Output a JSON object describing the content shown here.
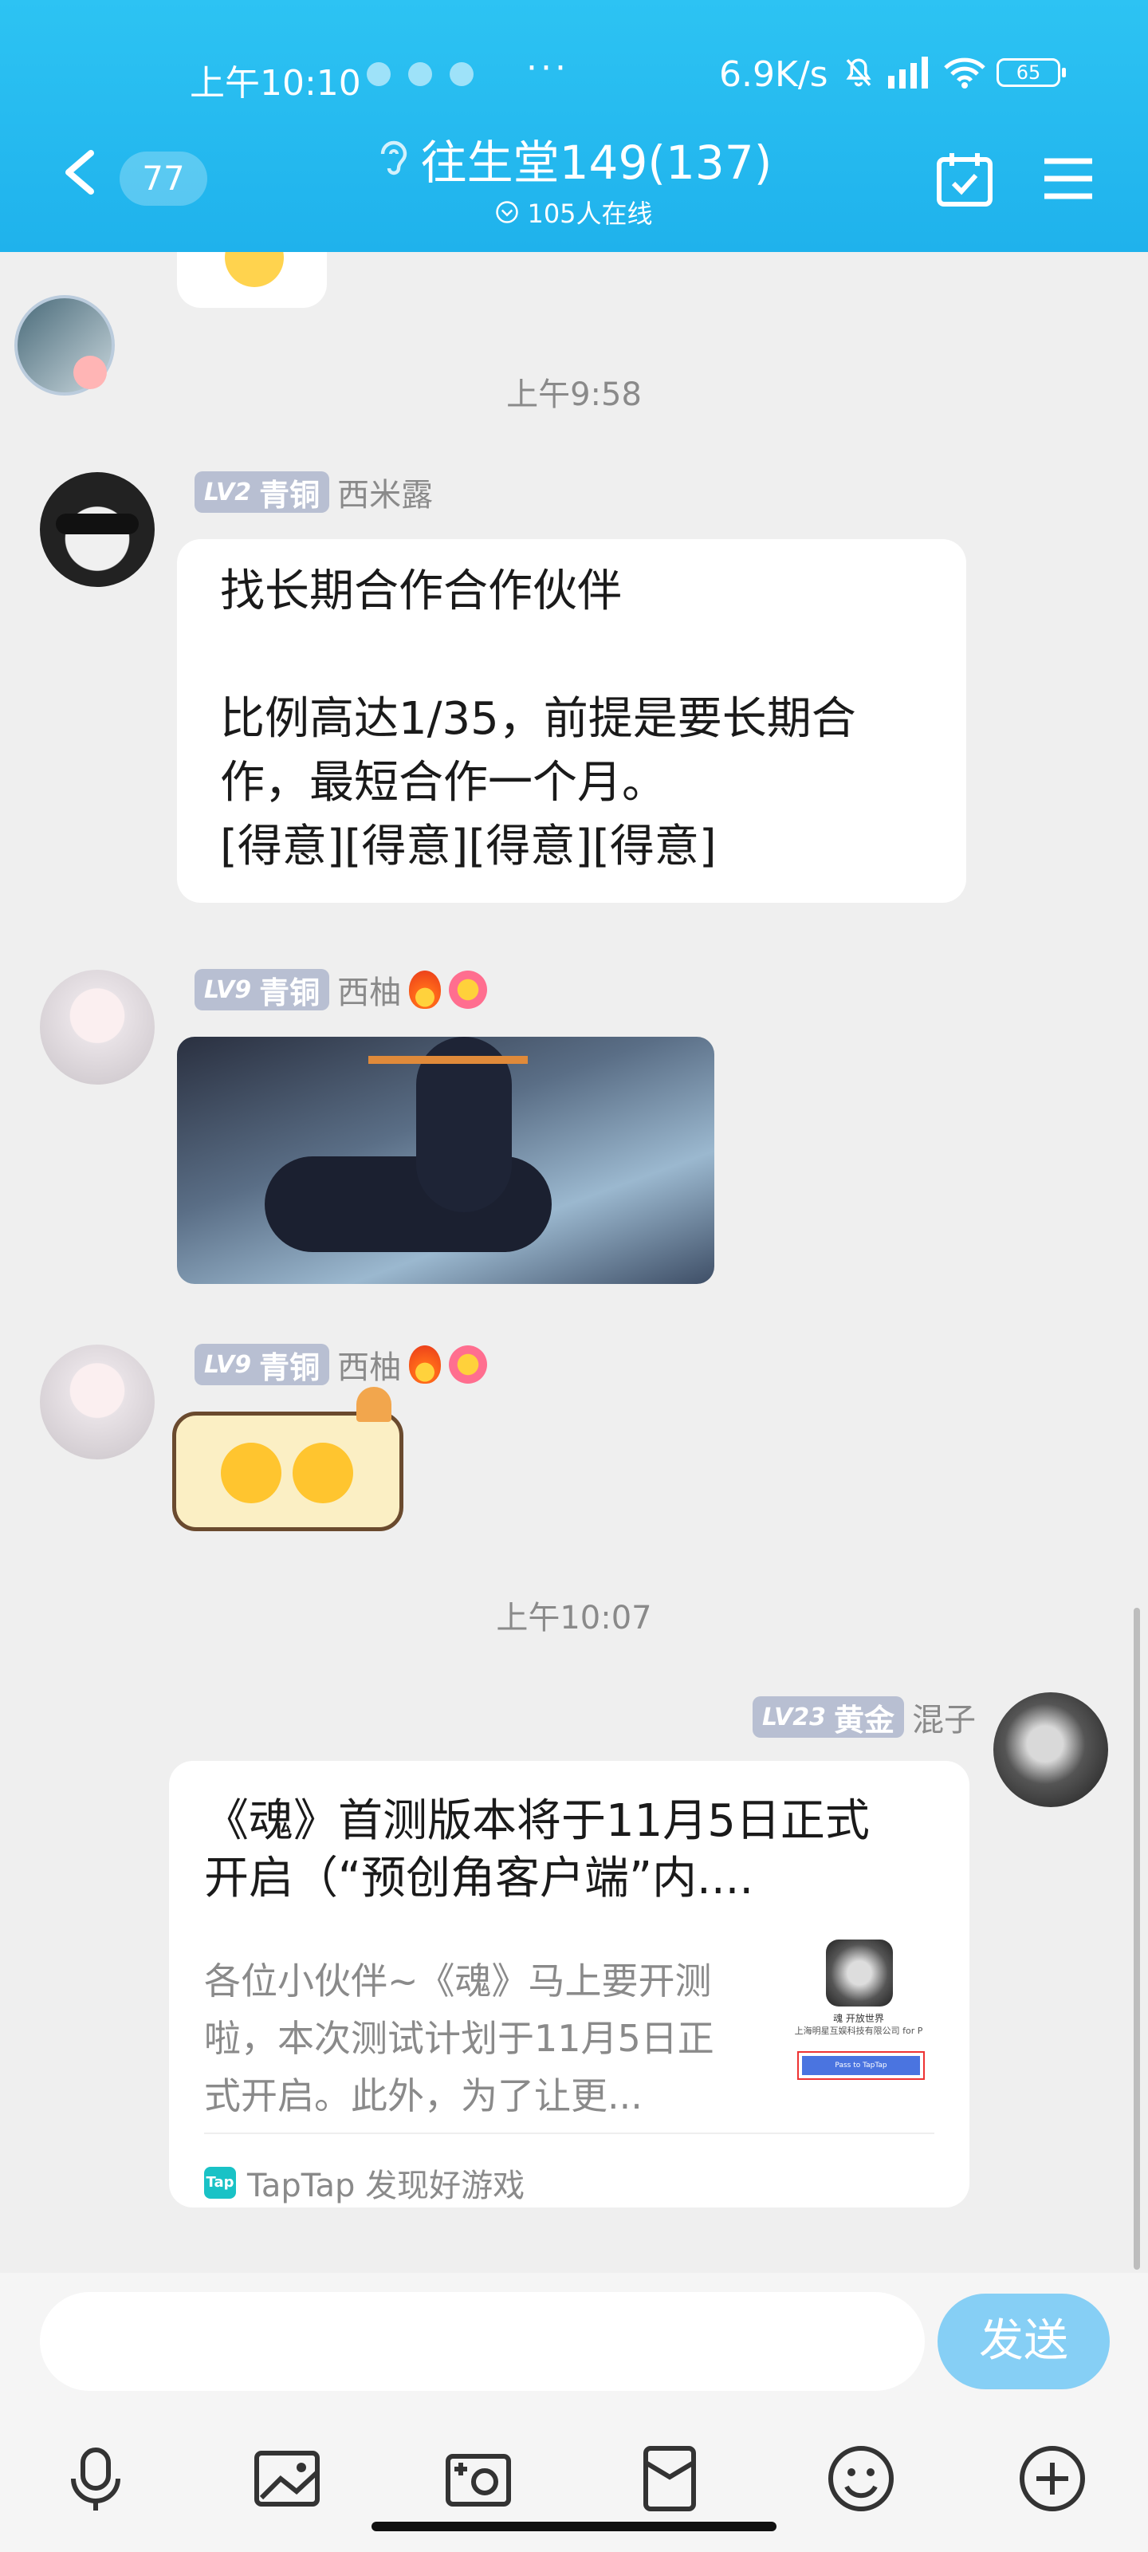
{
  "status_bar": {
    "time": "上午10:10",
    "dots": "···",
    "network_speed": "6.9K/s",
    "battery": "65"
  },
  "header": {
    "unread_count": "77",
    "group_title": "往生堂149(137)",
    "online_text": "105人在线"
  },
  "messages": [
    {
      "type": "timestamp",
      "text": "上午9:58"
    },
    {
      "type": "text",
      "level": "LV2",
      "rank": "青铜",
      "user": "西米露",
      "lines": [
        "找长期合作合作伙伴",
        "",
        "比例高达1/35，前提是要长期合",
        "作，最短合作一个月。",
        "[得意][得意][得意][得意]"
      ]
    },
    {
      "type": "image",
      "level": "LV9",
      "rank": "青铜",
      "user": "西柚"
    },
    {
      "type": "sticker",
      "level": "LV9",
      "rank": "青铜",
      "user": "西柚"
    },
    {
      "type": "timestamp",
      "text": "上午10:07"
    },
    {
      "type": "card",
      "level": "LV23",
      "rank": "黄金",
      "user": "混子",
      "title_lines": [
        "《魂》首测版本将于11月5日正式",
        "开启（“预创角客户端”内...."
      ],
      "desc_lines": [
        "各位小伙伴~《魂》马上要开测",
        "啦，本次测试计划于11月5日正",
        "式开启。此外，为了让更..."
      ],
      "thumb_caption_1": "魂 开放世界",
      "thumb_caption_2": "上海明星互娱科技有限公司 for P",
      "thumb_button": "Pass to TapTap",
      "source_logo": "Tap",
      "source": "TapTap 发现好游戏"
    }
  ],
  "composer": {
    "input_value": "",
    "send_label": "发送"
  },
  "toolbar": [
    "microphone-icon",
    "image-icon",
    "camera-icon",
    "red-packet-icon",
    "emoji-icon",
    "plus-icon"
  ],
  "colors": {
    "header": "#1fb2ec",
    "bubble": "#ffffff",
    "chat_bg": "#efefef",
    "level_badge": "#b8bfd2",
    "gold_badge": "#b8bfd2",
    "send_button": "#86cff5"
  }
}
